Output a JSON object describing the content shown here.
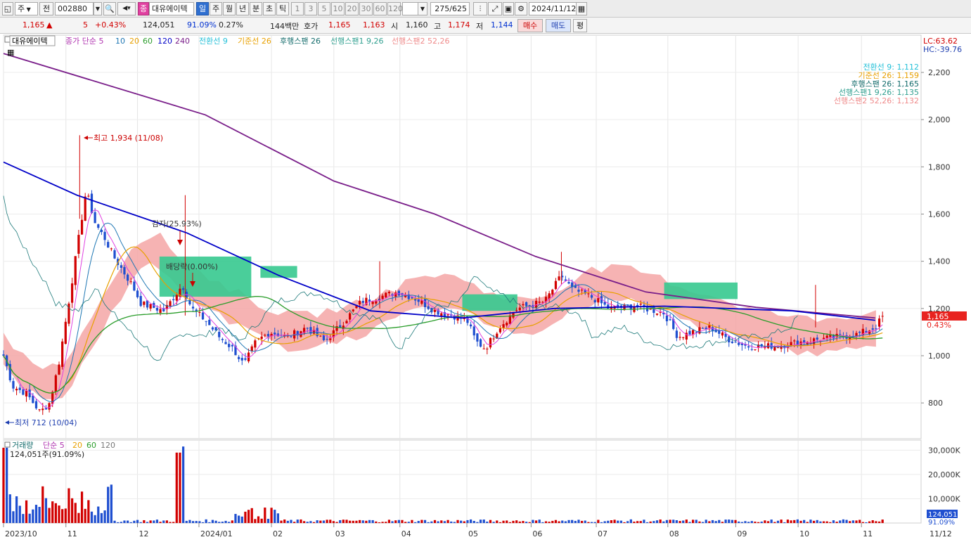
{
  "toolbar": {
    "chart_type": "주",
    "market_mode": "전",
    "code": "002880",
    "fav_badge": "종",
    "stock_name": "대유에이텍",
    "periods": [
      "일",
      "주",
      "월",
      "년",
      "분",
      "초",
      "틱"
    ],
    "active_period": "일",
    "intervals": [
      "1",
      "3",
      "5",
      "10",
      "20",
      "30",
      "60",
      "120"
    ],
    "page_counter": "275/625",
    "date": "2024/11/12"
  },
  "quote": {
    "price": "1,165",
    "change_arrow": "▲",
    "change": "5",
    "change_pct": "+0.43%",
    "volume": "124,051",
    "volume_ratio": "91.09%",
    "turnover": "0.27%",
    "amount": "144백만",
    "hoga_label": "호가",
    "ask": "1,165",
    "bid": "1,163",
    "open_label": "시",
    "open": "1,160",
    "high_label": "고",
    "high": "1,174",
    "low_label": "저",
    "low": "1,144",
    "buy_label": "매수",
    "sell_label": "매도",
    "eval_label": "평"
  },
  "legend": {
    "stock": "대유에이텍",
    "ma": "종가 단순 5",
    "ma_periods": [
      "10",
      "20",
      "60",
      "120",
      "240"
    ],
    "ichimoku": [
      "전환선 9",
      "기준선 26",
      "후행스팬 26",
      "선행스팬1 9,26",
      "선행스팬2 52,26"
    ],
    "lc": "LC:63.62",
    "hc": "HC:-39.76"
  },
  "ichimoku_values": [
    "전환선 9: 1,112",
    "기준선 26: 1,159",
    "후행스팬 26: 1,165",
    "선행스팬1 9,26: 1,135",
    "선행스팬2 52,26: 1,132"
  ],
  "annotations": {
    "high": "최고 1,934 (11/08)",
    "low": "최저 712 (10/04)",
    "capital_reduction": "감자(25.93%)",
    "dividend": "배당락(0.00%)"
  },
  "price_axis": {
    "ticks": [
      "2,200",
      "2,000",
      "1,800",
      "1,600",
      "1,400",
      "1,200",
      "1,000",
      "800"
    ],
    "current": "1,165",
    "current_pct": "0.43%"
  },
  "volume_legend": {
    "title": "거래량",
    "ma": "단순 5",
    "periods": [
      "20",
      "60",
      "120"
    ],
    "info": "124,051주(91.09%)"
  },
  "volume_axis": {
    "ticks": [
      "30,000K",
      "20,000K",
      "10,000K"
    ],
    "current": "124,051",
    "current_pct": "91.09%"
  },
  "x_axis": {
    "labels": [
      "2023/10",
      "11",
      "12",
      "2024/01",
      "02",
      "03",
      "04",
      "05",
      "06",
      "07",
      "08",
      "09",
      "10",
      "11",
      "11/12"
    ]
  },
  "colors": {
    "up": "#d20000",
    "down": "#1f4fd0",
    "ma5": "#e040e0",
    "ma10": "#1f77b4",
    "ma20": "#e8a000",
    "ma60": "#2a9d2a",
    "ma120": "#0000c8",
    "ma240": "#7a1f8a",
    "cloud_bear": "#f4a6a6",
    "cloud_bull": "#36c98f"
  },
  "chart_data": {
    "type": "candlestick",
    "price_ylim": [
      700,
      2300
    ],
    "volume_ylim": [
      0,
      33000
    ],
    "series_key_points": {
      "ma240": [
        [
          0,
          2280
        ],
        [
          0.22,
          2020
        ],
        [
          0.36,
          1740
        ],
        [
          0.47,
          1600
        ],
        [
          0.58,
          1420
        ],
        [
          0.7,
          1270
        ],
        [
          0.82,
          1205
        ],
        [
          0.95,
          1160
        ]
      ],
      "ma120": [
        [
          0,
          1820
        ],
        [
          0.08,
          1680
        ],
        [
          0.2,
          1520
        ],
        [
          0.3,
          1340
        ],
        [
          0.4,
          1190
        ],
        [
          0.5,
          1160
        ],
        [
          0.6,
          1200
        ],
        [
          0.72,
          1210
        ],
        [
          0.86,
          1190
        ],
        [
          0.95,
          1150
        ]
      ]
    }
  }
}
